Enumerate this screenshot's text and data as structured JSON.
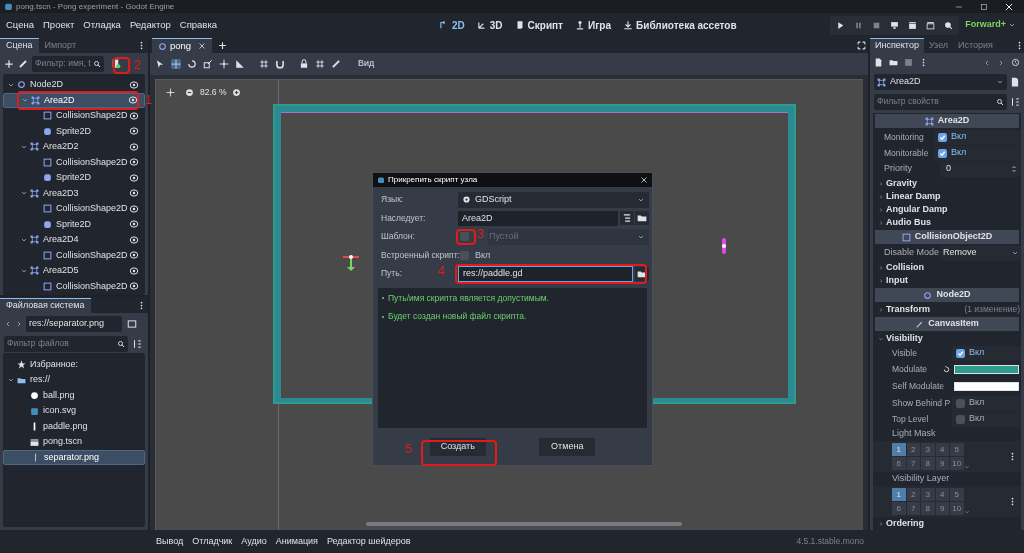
{
  "window": {
    "title": "pong.tscn - Pong experiment - Godot Engine"
  },
  "menu": [
    "Сцена",
    "Проект",
    "Отладка",
    "Редактор",
    "Справка"
  ],
  "workspaces": [
    {
      "label": "2D",
      "kind": "plane",
      "selected": true
    },
    {
      "label": "3D",
      "kind": "space",
      "selected": false
    },
    {
      "label": "Скрипт",
      "kind": "script",
      "selected": false
    },
    {
      "label": "Игра",
      "kind": "game",
      "selected": false
    },
    {
      "label": "Библиотека ассетов",
      "kind": "assets",
      "selected": false
    }
  ],
  "renderer": "Forward+",
  "scene_dock": {
    "tabs": [
      {
        "label": "Сцена",
        "selected": true
      },
      {
        "label": "Импорт",
        "selected": false
      }
    ],
    "filter_placeholder": "Фильтр: имя, t",
    "tree": [
      {
        "name": "Node2D",
        "kind": "node2d",
        "expanded": true,
        "selected": false,
        "children": [
          {
            "name": "Area2D",
            "kind": "area",
            "expanded": true,
            "selected": true,
            "children": [
              {
                "name": "CollisionShape2D",
                "kind": "shape",
                "selected": false
              },
              {
                "name": "Sprite2D",
                "kind": "sprite",
                "selected": false
              }
            ]
          },
          {
            "name": "Area2D2",
            "kind": "area",
            "expanded": true,
            "selected": false,
            "children": [
              {
                "name": "CollisionShape2D",
                "kind": "shape",
                "selected": false
              },
              {
                "name": "Sprite2D",
                "kind": "sprite",
                "selected": false
              }
            ]
          },
          {
            "name": "Area2D3",
            "kind": "area",
            "expanded": true,
            "selected": false,
            "children": [
              {
                "name": "CollisionShape2D",
                "kind": "shape",
                "selected": false
              },
              {
                "name": "Sprite2D",
                "kind": "sprite",
                "selected": false
              }
            ]
          },
          {
            "name": "Area2D4",
            "kind": "area",
            "expanded": true,
            "selected": false,
            "children": [
              {
                "name": "CollisionShape2D",
                "kind": "shape",
                "selected": false
              }
            ]
          },
          {
            "name": "Area2D5",
            "kind": "area",
            "expanded": true,
            "selected": false,
            "children": [
              {
                "name": "CollisionShape2D",
                "kind": "shape",
                "selected": false
              }
            ]
          }
        ]
      }
    ]
  },
  "filesystem": {
    "tab": "Файловая система",
    "path": "res://separator.png",
    "filter_placeholder": "Фильтр файлов",
    "favorites": "Избранное:",
    "tree": [
      {
        "name": "res://",
        "kind": "folder",
        "expanded": true,
        "selected": false,
        "children": [
          {
            "name": "ball.png",
            "kind": "ball",
            "selected": false
          },
          {
            "name": "icon.svg",
            "kind": "svgfile",
            "selected": false
          },
          {
            "name": "paddle.png",
            "kind": "paddle",
            "selected": false
          },
          {
            "name": "pong.tscn",
            "kind": "scene",
            "selected": false
          },
          {
            "name": "separator.png",
            "kind": "separator",
            "selected": true
          }
        ]
      }
    ]
  },
  "editor": {
    "tabs": [
      {
        "label": "pong",
        "selected": true
      }
    ],
    "view_menu": "Вид",
    "zoom": "82.6 %"
  },
  "dialog": {
    "title": "Прикрепить скрипт узла",
    "rows": [
      {
        "kind": "dropdown",
        "label": "Язык:",
        "value": "GDScript"
      },
      {
        "kind": "text",
        "label": "Наследует:",
        "value": "Area2D"
      },
      {
        "kind": "template",
        "label": "Шаблон:",
        "checked": false,
        "value": "Пустой",
        "disabled": true
      },
      {
        "kind": "check",
        "label": "Встроенный скрипт:",
        "checked": false,
        "value": "Вкл"
      },
      {
        "kind": "path",
        "label": "Путь:",
        "value": "res://paddle.gd"
      }
    ],
    "messages": [
      "Путь/имя скрипта является допустимым.",
      "Будет создан новый файл скрипта."
    ],
    "buttons": [
      "Создать",
      "Отмена"
    ]
  },
  "annotations": [
    "1",
    "2",
    "3",
    "4",
    "5"
  ],
  "inspector": {
    "tabs": [
      {
        "label": "Инспектор",
        "selected": true
      },
      {
        "label": "Узел",
        "selected": false
      },
      {
        "label": "История",
        "selected": false
      }
    ],
    "node": "Area2D",
    "filter_placeholder": "Фильтр свойств",
    "rows": [
      {
        "kind": "header",
        "label": "Area2D"
      },
      {
        "kind": "check",
        "label": "Monitoring",
        "checked": true,
        "value": "Вкл"
      },
      {
        "kind": "check",
        "label": "Monitorable",
        "checked": true,
        "value": "Вкл"
      },
      {
        "kind": "number",
        "label": "Priority",
        "value": "0"
      },
      {
        "kind": "group",
        "label": "Gravity",
        "expanded": false
      },
      {
        "kind": "group",
        "label": "Linear Damp",
        "expanded": false
      },
      {
        "kind": "group",
        "label": "Angular Damp",
        "expanded": false
      },
      {
        "kind": "group",
        "label": "Audio Bus",
        "expanded": false
      },
      {
        "kind": "header",
        "label": "CollisionObject2D"
      },
      {
        "kind": "select",
        "label": "Disable Mode",
        "value": "Remove"
      },
      {
        "kind": "group",
        "label": "Collision",
        "expanded": false
      },
      {
        "kind": "group",
        "label": "Input",
        "expanded": false
      },
      {
        "kind": "header",
        "label": "Node2D"
      },
      {
        "kind": "group",
        "label": "Transform",
        "expanded": false,
        "note": "(1 изменение)"
      },
      {
        "kind": "header",
        "label": "CanvasItem"
      },
      {
        "kind": "group",
        "label": "Visibility",
        "expanded": true,
        "children": [
          {
            "kind": "check",
            "label": "Visible",
            "checked": true,
            "value": "Вкл"
          },
          {
            "kind": "color",
            "label": "Modulate",
            "color": "#2e9c8d",
            "revert": true
          },
          {
            "kind": "color",
            "label": "Self Modulate",
            "color": "#ffffff",
            "revert": false
          },
          {
            "kind": "check",
            "label": "Show Behind P",
            "checked": false,
            "value": "Вкл"
          },
          {
            "kind": "check",
            "label": "Top Level",
            "checked": false,
            "value": "Вкл"
          },
          {
            "kind": "label",
            "label": "Light Mask"
          },
          {
            "kind": "layers",
            "cells": [
              {
                "label": "1",
                "selected": true
              },
              {
                "label": "2",
                "selected": false
              },
              {
                "label": "3",
                "selected": false
              },
              {
                "label": "4",
                "selected": false
              },
              {
                "label": "5",
                "selected": false
              },
              {
                "label": "6",
                "selected": false
              },
              {
                "label": "7",
                "selected": false
              },
              {
                "label": "8",
                "selected": false
              },
              {
                "label": "9",
                "selected": false
              },
              {
                "label": "10",
                "selected": false
              }
            ]
          },
          {
            "kind": "label",
            "label": "Visibility Layer"
          },
          {
            "kind": "layers",
            "cells": [
              {
                "label": "1",
                "selected": true
              },
              {
                "label": "2",
                "selected": false
              },
              {
                "label": "3",
                "selected": false
              },
              {
                "label": "4",
                "selected": false
              },
              {
                "label": "5",
                "selected": false
              },
              {
                "label": "6",
                "selected": false
              },
              {
                "label": "7",
                "selected": false
              },
              {
                "label": "8",
                "selected": false
              },
              {
                "label": "9",
                "selected": false
              },
              {
                "label": "10",
                "selected": false
              }
            ]
          }
        ]
      },
      {
        "kind": "group",
        "label": "Ordering",
        "expanded": false
      }
    ]
  },
  "bottom_panel": {
    "tabs": [
      "Вывод",
      "Отладчик",
      "Аудио",
      "Анимация",
      "Редактор шейдеров"
    ],
    "version": "4.5.1.stable.mono"
  }
}
